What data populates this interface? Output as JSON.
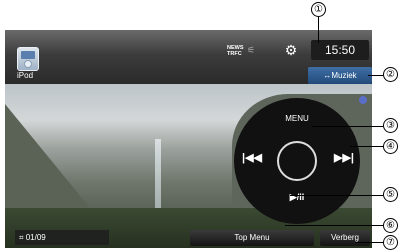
{
  "callouts": [
    "①",
    "②",
    "③",
    "④",
    "⑤",
    "⑥",
    "⑦"
  ],
  "header": {
    "source_label": "iPod",
    "news_label": "NEWS",
    "trfc_label": "TRFC",
    "settings_icon_glyph": "⚙",
    "clock": "15:50",
    "muziek_button": "↔Muziek"
  },
  "controller": {
    "menu_label": "MENU",
    "prev_glyph": "|◀◀",
    "next_glyph": "▶▶|",
    "playpause_glyph": "▶/II"
  },
  "footer": {
    "track_counter": "01/09",
    "top_menu_button": "Top Menu",
    "verberg_button": "Verberg"
  },
  "icons": {
    "ipod": "ipod-icon",
    "settings": "gear-icon",
    "chapter": "chapter-icon"
  }
}
